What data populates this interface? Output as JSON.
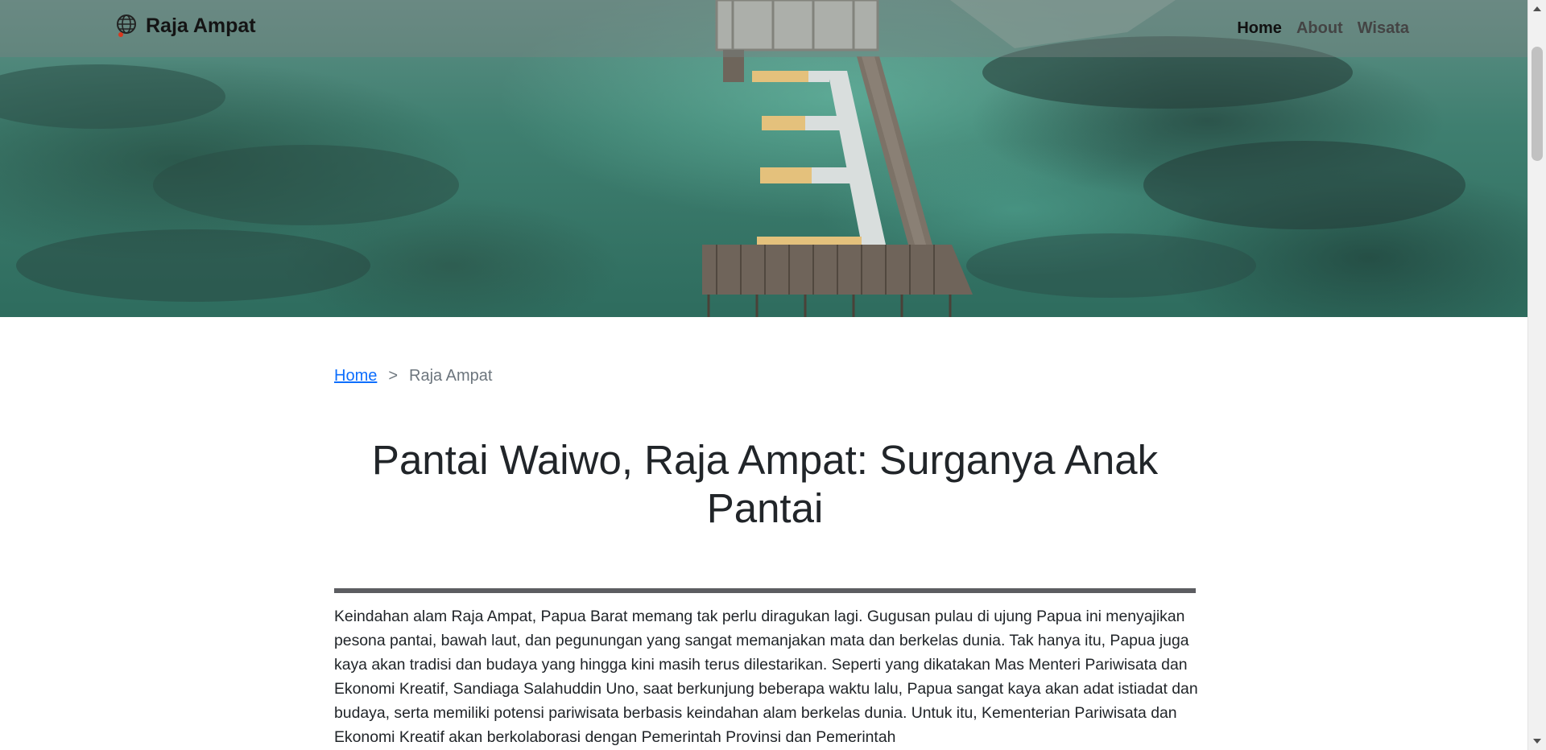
{
  "navbar": {
    "brand": "Raja Ampat",
    "brand_icon": "globe-icon",
    "links": [
      {
        "label": "Home",
        "active": true
      },
      {
        "label": "About",
        "active": false
      },
      {
        "label": "Wisata",
        "active": false
      }
    ]
  },
  "hero": {
    "description_icon": "pier-photo"
  },
  "breadcrumb": {
    "home": "Home",
    "separator": ">",
    "current": "Raja Ampat"
  },
  "article": {
    "title": "Pantai Waiwo, Raja Ampat: Surganya Anak Pantai",
    "body": "Keindahan alam Raja Ampat, Papua Barat memang tak perlu diragukan lagi. Gugusan pulau di ujung Papua ini menyajikan pesona pantai, bawah laut, dan pegunungan yang sangat memanjakan mata dan berkelas dunia. Tak hanya itu, Papua juga kaya akan tradisi dan budaya yang hingga kini masih terus dilestarikan. Seperti yang dikatakan Mas Menteri Pariwisata dan Ekonomi Kreatif, Sandiaga Salahuddin Uno, saat berkunjung beberapa waktu lalu, Papua sangat kaya akan adat istiadat dan budaya, serta memiliki potensi pariwisata berbasis keindahan alam berkelas dunia. Untuk itu, Kementerian Pariwisata dan Ekonomi Kreatif akan berkolaborasi dengan Pemerintah Provinsi dan Pemerintah"
  },
  "colors": {
    "link": "#0d6efd",
    "divider": "#5c5d61",
    "text": "#212529",
    "sea": "#3f7f70"
  }
}
